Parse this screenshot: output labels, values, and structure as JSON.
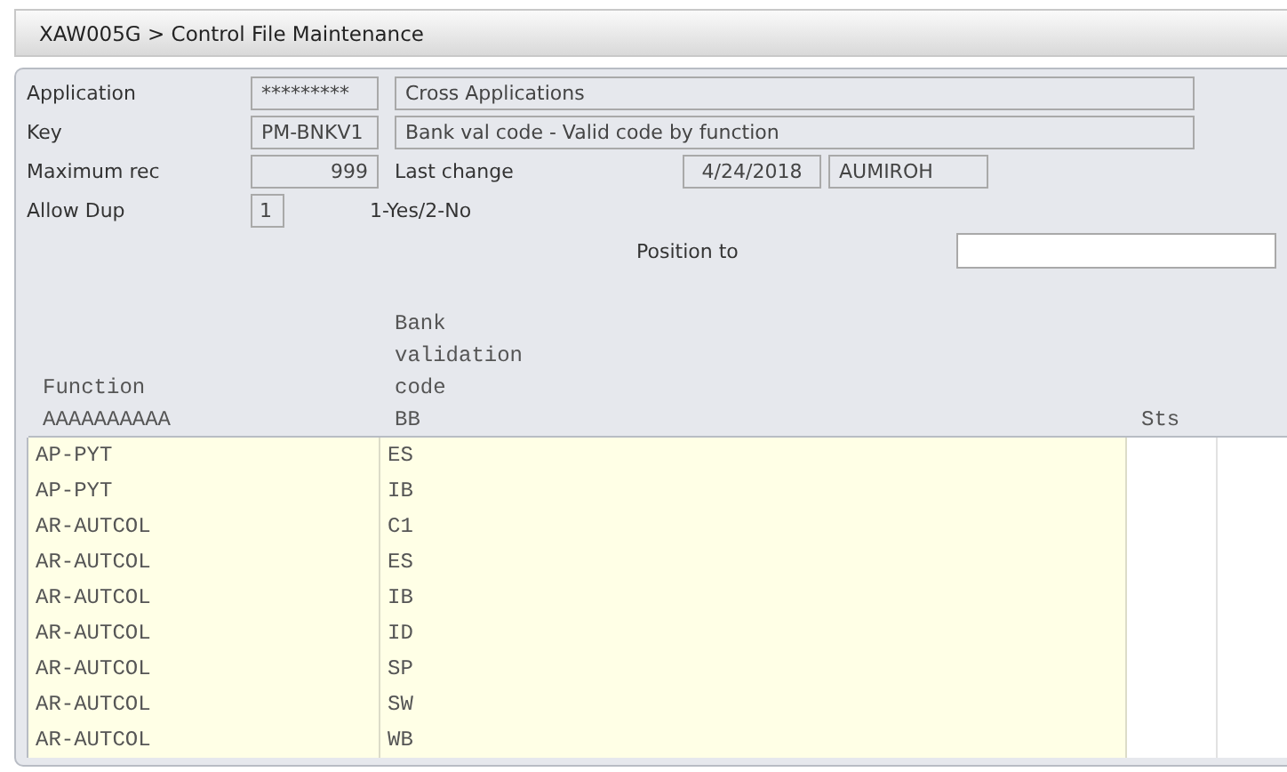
{
  "window": {
    "title": "XAW005G > Control File Maintenance"
  },
  "form": {
    "rows": [
      {
        "label": "Application",
        "code": "*********",
        "kind": "text",
        "description": "Cross Applications"
      },
      {
        "label": "Key",
        "code": "PM-BNKV1",
        "kind": "text",
        "description": "Bank val code - Valid code by function"
      },
      {
        "label": "Maximum rec",
        "code": "999",
        "kind": "number",
        "extra_label": "Last change",
        "date": "4/24/2018",
        "user": "AUMIROH"
      },
      {
        "label": "Allow Dup",
        "flag": "1",
        "hint": "1-Yes/2-No"
      }
    ],
    "position": {
      "label": "Position to"
    }
  },
  "table": {
    "columns": [
      {
        "label": "Function",
        "mask": "AAAAAAAAAA"
      },
      {
        "label": "Bank validation code",
        "mask": "BB"
      },
      {
        "label": "Sts"
      }
    ],
    "rows": [
      {
        "function": "AP-PYT",
        "code": "ES"
      },
      {
        "function": "AP-PYT",
        "code": "IB"
      },
      {
        "function": "AR-AUTCOL",
        "code": "C1"
      },
      {
        "function": "AR-AUTCOL",
        "code": "ES"
      },
      {
        "function": "AR-AUTCOL",
        "code": "IB"
      },
      {
        "function": "AR-AUTCOL",
        "code": "ID"
      },
      {
        "function": "AR-AUTCOL",
        "code": "SP"
      },
      {
        "function": "AR-AUTCOL",
        "code": "SW"
      },
      {
        "function": "AR-AUTCOL",
        "code": "WB"
      }
    ]
  }
}
